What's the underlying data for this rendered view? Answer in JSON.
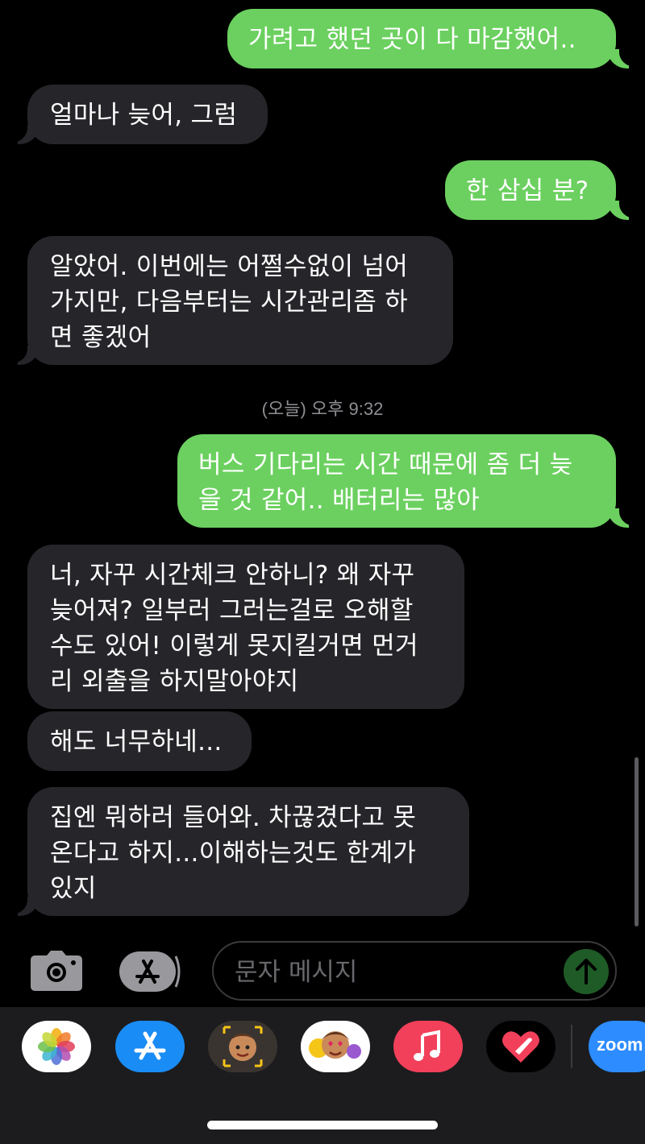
{
  "conversation": {
    "messages": [
      {
        "direction": "sent",
        "text": "가려고 했던 곳이 다 마감했어.."
      },
      {
        "direction": "received",
        "text": "얼마나 늦어, 그럼"
      },
      {
        "direction": "sent",
        "text": "한 삼십 분?"
      },
      {
        "direction": "received",
        "text": "알았어. 이번에는 어쩔수없이 넘어\n가지만, 다음부터는 시간관리좀 하\n면 좋겠어"
      },
      {
        "direction": "sent",
        "text": "버스 기다리는 시간 때문에 좀 더 늦\n을 것 같어.. 배터리는 많아"
      },
      {
        "direction": "received",
        "text": "너, 자꾸 시간체크 안하니? 왜 자꾸\n늦어져? 일부러 그러는걸로 오해할\n수도 있어! 이렇게 못지킬거면 먼거\n리 외출을 하지말아야지"
      },
      {
        "direction": "received",
        "text": "해도 너무하네..."
      },
      {
        "direction": "received",
        "text": "집엔 뭐하러 들어와. 차끊겼다고 못\n온다고 하지...이해하는것도 한계가\n있지"
      }
    ],
    "timestamp": "(오늘) 오후 9:32"
  },
  "composer": {
    "placeholder": "문자 메시지",
    "camera_icon": "camera-icon",
    "apps_icon": "app-store-icon",
    "send_icon": "arrow-up-icon"
  },
  "app_drawer": {
    "apps": [
      {
        "name": "photos",
        "icon": "photos-icon"
      },
      {
        "name": "app-store",
        "icon": "app-store-icon"
      },
      {
        "name": "memoji-camera",
        "icon": "memoji-icon"
      },
      {
        "name": "animoji-stickers",
        "icon": "memoji-stickers-icon"
      },
      {
        "name": "music",
        "icon": "music-note-icon"
      },
      {
        "name": "digital-touch",
        "icon": "heart-icon"
      },
      {
        "name": "zoom",
        "label": "zoom",
        "icon": "zoom-icon"
      }
    ]
  },
  "colors": {
    "sent_bubble": "#6bd05f",
    "received_bubble": "#26262a",
    "background": "#000000",
    "timestamp": "#8e8e93"
  }
}
